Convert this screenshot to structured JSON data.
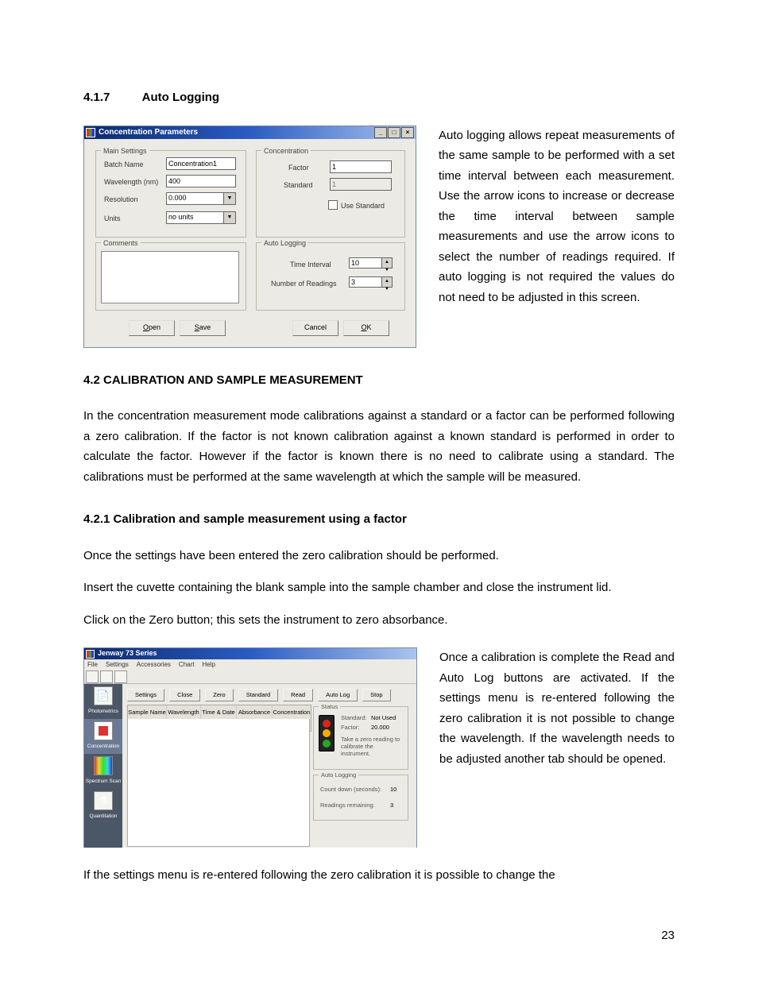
{
  "doc": {
    "h1_num": "4.1.7",
    "h1_txt": "Auto Logging",
    "p1": "Auto logging allows repeat measurements of the same sample to be performed with a set time interval between each measurement. Use the arrow icons to increase or decrease the time interval between sample measurements and use the arrow icons to select the number of readings required. If auto logging is not required the values do not need to be adjusted in this screen.",
    "h2_num": "4.2",
    "h2_txt": "CALIBRATION AND SAMPLE MEASUREMENT",
    "p2": "In the concentration measurement mode calibrations against a standard or a factor can be performed following a zero calibration. If the factor is not known calibration against a known standard is performed in order to calculate the factor. However if the factor is known there is no need to calibrate using a standard. The calibrations must be performed at the same wavelength at which the sample will be measured.",
    "h3_num": "4.2.1",
    "h3_txt": "Calibration and sample measurement using a factor",
    "p3": "Once the settings have been entered the zero calibration should be performed.",
    "p4": "Insert the cuvette containing the blank sample into the sample chamber and close the instrument lid.",
    "p5": "Click on the Zero button; this sets the instrument to zero absorbance.",
    "p6": "Once a calibration is complete the Read and Auto Log buttons are activated. If the settings menu is re-entered following the zero calibration it is not possible to change the wavelength. If the wavelength needs to be adjusted another tab should be opened.",
    "p7": "If the settings menu is re-entered following the zero calibration it is possible to change the",
    "pagenum": "23"
  },
  "w1": {
    "title": "Concentration Parameters",
    "groups": {
      "ms": "Main Settings",
      "conc": "Concentration",
      "cmt": "Comments",
      "al": "Auto Logging"
    },
    "labels": {
      "batch": "Batch Name",
      "wl": "Wavelength (nm)",
      "res": "Resolution",
      "units": "Units",
      "factor": "Factor",
      "std": "Standard",
      "useStd": "Use Standard",
      "ti": "Time Interval",
      "nr": "Number of Readings"
    },
    "values": {
      "batch": "Concentration1",
      "wl": "400",
      "res": "0.000",
      "units": "no units",
      "factor": "1",
      "std": "1",
      "ti": "10",
      "nr": "3"
    },
    "buttons": {
      "open": "Open",
      "save": "Save",
      "cancel": "Cancel",
      "ok": "OK"
    }
  },
  "w2": {
    "title": "Jenway 73 Series",
    "menu": [
      "File",
      "Settings",
      "Accessories",
      "Chart",
      "Help"
    ],
    "side": [
      "Photometrics",
      "Concentration",
      "Spectrum Scan",
      "Quantitation"
    ],
    "btns": [
      "Settings",
      "Close",
      "Zero",
      "Standard",
      "Read",
      "Auto Log",
      "Stop"
    ],
    "cols": [
      "Sample Name",
      "Wavelength (nm)",
      "Time & Date",
      "Absorbance",
      "Concentration (ppm)"
    ],
    "status": {
      "group": "Status",
      "std": "Standard:",
      "stdv": "Not Used",
      "fac": "Factor:",
      "facv": "20.000",
      "msg": "Take a zero reading to calibrate the instrument."
    },
    "al": {
      "group": "Auto Logging",
      "cd": "Count down (seconds):",
      "cdv": "10",
      "rr": "Readings remaining:",
      "rrv": "3"
    }
  }
}
